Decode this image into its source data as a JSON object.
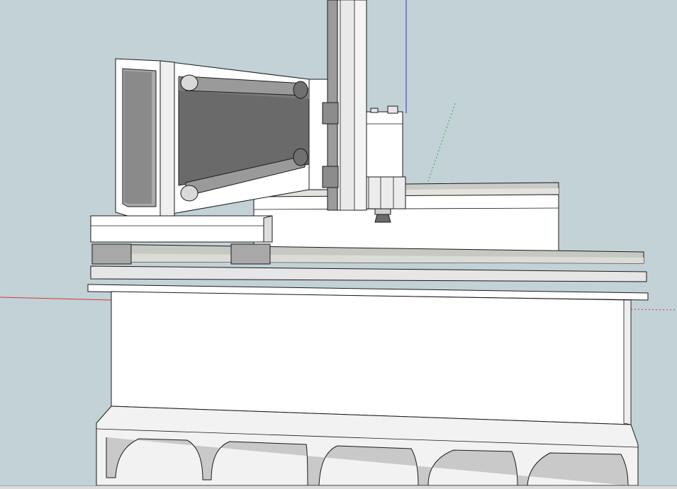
{
  "viewport": {
    "background": "#c2d2d7",
    "edge_color": "#1a1a1a",
    "shade_dark": "#5c5c5c",
    "shade_mid": "#8e8e8e",
    "shade_light": "#d4d4d4",
    "face_white": "#ffffff"
  },
  "axes": {
    "red_axis": "#d23a3a",
    "green_axis": "#2fb02f",
    "blue_axis": "#2f2fd6"
  },
  "model": {
    "parts": [
      "ground-axis-red",
      "ground-axis-green",
      "ground-axis-blue",
      "table-base-beam",
      "table-legs",
      "front-rail",
      "rear-rail",
      "y-carriage",
      "gantry-beam",
      "z-axis-plate",
      "spindle-motor",
      "spindle-collet"
    ]
  },
  "status_bar": {
    "present": true
  }
}
